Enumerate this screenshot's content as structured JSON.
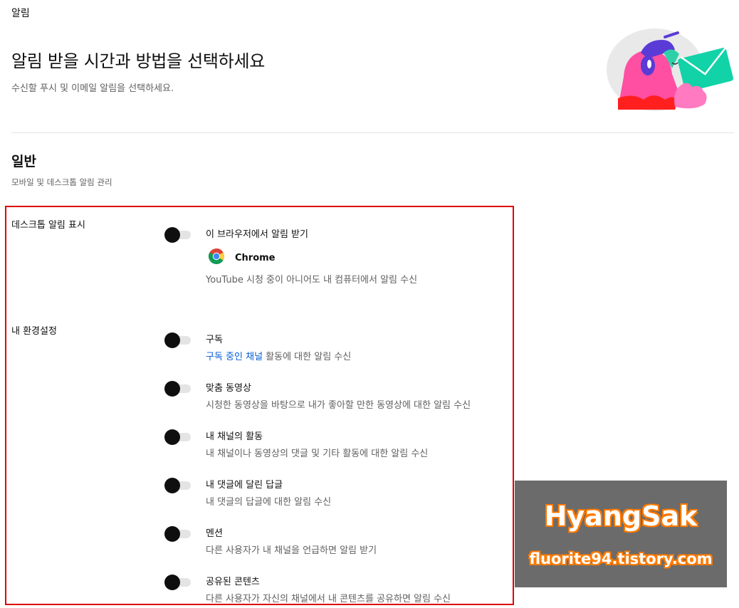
{
  "header": {
    "section": "알림",
    "title": "알림 받을 시간과 방법을 선택하세요",
    "subtitle": "수신할 푸시 및 이메일 알림을 선택하세요."
  },
  "general": {
    "title": "일반",
    "subtitle": "모바일 및 데스크톱 알림 관리"
  },
  "desktop": {
    "label": "데스크톱 알림 표시",
    "option_title": "이 브라우저에서 알림 받기",
    "browser_name": "Chrome",
    "browser_icon": "chrome-icon",
    "option_desc": "YouTube 시청 중이 아니어도 내 컴퓨터에서 알림 수신",
    "enabled": false
  },
  "preferences": {
    "label": "내 환경설정",
    "items": [
      {
        "title": "구독",
        "desc_link": "구독 중인 채널",
        "desc": " 활동에 대한 알림 수신",
        "enabled": false
      },
      {
        "title": "맞춤 동영상",
        "desc": "시청한 동영상을 바탕으로 내가 좋아할 만한 동영상에 대한 알림 수신",
        "enabled": false
      },
      {
        "title": "내 채널의 활동",
        "desc": "내 채널이나 동영상의 댓글 및 기타 활동에 대한 알림 수신",
        "enabled": false
      },
      {
        "title": "내 댓글에 달린 답글",
        "desc": "내 댓글의 답글에 대한 알림 수신",
        "enabled": false
      },
      {
        "title": "멘션",
        "desc": "다른 사용자가 내 채널을 언급하면 알림 받기",
        "enabled": false
      },
      {
        "title": "공유된 콘텐츠",
        "desc": "다른 사용자가 자신의 채널에서 내 콘텐츠를 공유하면 알림 수신",
        "enabled": false
      }
    ]
  },
  "watermark": {
    "title": "HyangSak",
    "url": "fluorite94.tistory.com"
  },
  "colors": {
    "highlight": "#e00000",
    "link": "#065fd4",
    "watermark_bg": "#6b6b6b",
    "watermark_outline": "#ff7a00"
  }
}
